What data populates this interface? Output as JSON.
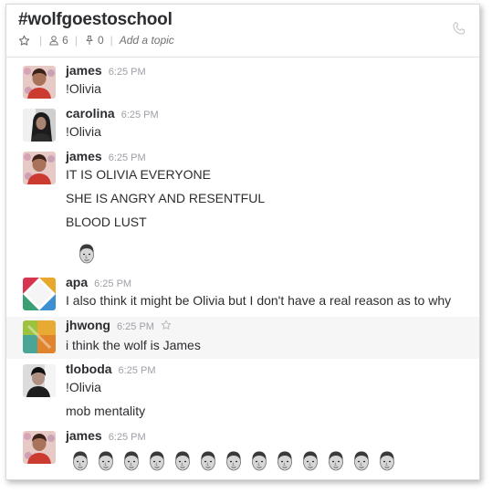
{
  "channel": {
    "name": "#wolfgoestoschool",
    "members_count": "6",
    "pinned_count": "0",
    "topic_placeholder": "Add a topic",
    "icons": [
      "star-icon",
      "member-icon",
      "pin-icon",
      "phone-icon"
    ]
  },
  "messages": [
    {
      "user": "james",
      "time": "6:25 PM",
      "lines": [
        "!Olivia"
      ]
    },
    {
      "user": "carolina",
      "time": "6:25 PM",
      "lines": [
        "!Olivia"
      ]
    },
    {
      "user": "james",
      "time": "6:25 PM",
      "lines": [
        "IT IS OLIVIA EVERYONE",
        "SHE IS ANGRY AND RESENTFUL",
        "BLOOD LUST"
      ]
    },
    {
      "user": "apa",
      "time": "6:25 PM",
      "lines": [
        "I also think it might be Olivia but I don't have a real reason as to why"
      ]
    },
    {
      "user": "jhwong",
      "time": "6:25 PM",
      "lines": [
        "i think the wolf is James"
      ]
    },
    {
      "user": "tloboda",
      "time": "6:25 PM",
      "lines": [
        "!Olivia",
        "mob mentality"
      ]
    },
    {
      "user": "james",
      "time": "6:25 PM",
      "lines": []
    }
  ],
  "emoji": {
    "name": "custom-face-emoji",
    "single_count": 1,
    "row_count": 13
  },
  "colors": {
    "text": "#2c2d30",
    "muted": "#9e9ea6",
    "hover_bg": "#f6f6f6"
  }
}
